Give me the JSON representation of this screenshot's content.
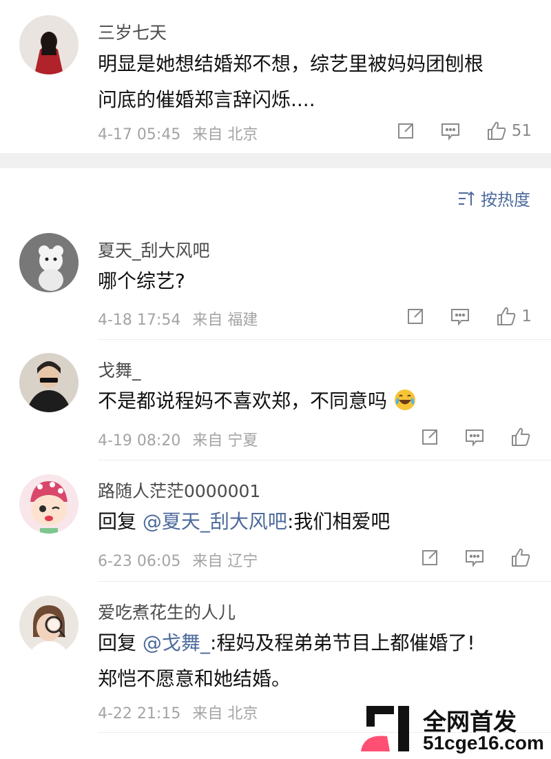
{
  "comments": [
    {
      "username": "三岁七天",
      "lines": [
        "明显是她想结婚郑不想，综艺里被妈妈团刨根",
        "问底的催婚郑言辞闪烁...."
      ],
      "time": "4-17 05:45",
      "source": "来自",
      "location": "北京",
      "likes": "51"
    },
    {
      "username": "夏天_刮大风吧",
      "lines": [
        "哪个综艺?"
      ],
      "time": "4-18 17:54",
      "source": "来自",
      "location": "福建",
      "likes": "1"
    },
    {
      "username": "戈舞_",
      "lines": [
        "不是都说程妈不喜欢郑，不同意吗"
      ],
      "emoji": "laugh-cry-emoji",
      "time": "4-19 08:20",
      "source": "来自",
      "location": "宁夏",
      "likes": ""
    },
    {
      "username": "路随人茫茫0000001",
      "reply_prefix": "回复",
      "mention": "@夏天_刮大风吧",
      "reply_text": ":我们相爱吧",
      "time": "6-23 06:05",
      "source": "来自",
      "location": "辽宁",
      "likes": ""
    },
    {
      "username": "爱吃煮花生的人儿",
      "reply_prefix": "回复",
      "mention": "@戈舞_",
      "reply_text": ":程妈及程弟弟节目上都催婚了!",
      "line2": "郑恺不愿意和她结婚。",
      "time": "4-22 21:15",
      "source": "来自",
      "location": "北京",
      "likes": ""
    }
  ],
  "sort": {
    "label": "按热度",
    "icon": "sort-icon"
  },
  "watermark": {
    "title": "全网首发",
    "domain": "51cge16.com"
  },
  "icons": {
    "repost": "repost-icon",
    "comment": "comment-icon",
    "like": "thumbs-up-icon"
  },
  "colors": {
    "link": "#4d6a9c",
    "meta": "#a4a4a4",
    "band": "#f0f0f0"
  }
}
